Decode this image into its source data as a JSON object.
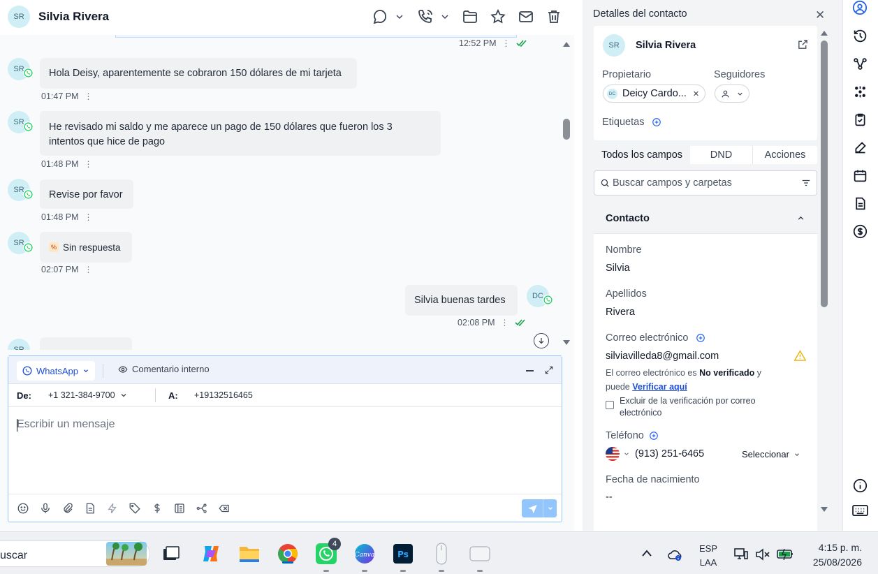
{
  "contact": {
    "initials": "SR",
    "name": "Silvia Rivera"
  },
  "messages": [
    {
      "time": "12:52 PM"
    },
    {
      "initials": "SR",
      "text": "Hola Deisy, aparentemente se cobraron 150 dólares de mi tarjeta",
      "time": "01:47 PM"
    },
    {
      "initials": "SR",
      "text_line1": "He revisado mi saldo y me aparece un pago de 150 dólares que fueron los 3",
      "text_line2": "intentos que hice de pago",
      "time": "01:48 PM"
    },
    {
      "initials": "SR",
      "text": "Revise por favor",
      "time": "01:48 PM"
    },
    {
      "initials": "SR",
      "text": "Sin respuesta",
      "time": "02:07 PM"
    },
    {
      "initials": "DC",
      "text": "Silvia buenas tardes",
      "time": "02:08 PM"
    },
    {
      "initials": "SR"
    }
  ],
  "composer": {
    "channel": "WhatsApp",
    "internal_comment": "Comentario interno",
    "from_label": "De:",
    "from_number": "+1 321-384-9700",
    "to_label": "A:",
    "to_number": "+19132516465",
    "placeholder": "Escribir un mensaje"
  },
  "panel": {
    "title": "Detalles del contacto",
    "contact_initials": "SR",
    "contact_name": "Silvia Rivera",
    "owner_label": "Propietario",
    "owner_initials": "DC",
    "owner_name": "Deicy Cardo...",
    "followers_label": "Seguidores",
    "tags_label": "Etiquetas",
    "tabs": [
      "Todos los campos",
      "DND",
      "Acciones"
    ],
    "search_placeholder": "Buscar campos y carpetas",
    "section_title": "Contacto",
    "first_name_label": "Nombre",
    "first_name": "Silvia",
    "last_name_label": "Apellidos",
    "last_name": "Rivera",
    "email_label": "Correo electrónico",
    "email": "silviavilleda8@gmail.com",
    "email_note_1": "El correo electrónico es",
    "email_note_bold": "No verificado",
    "email_note_2": "y",
    "email_note_3": "puede",
    "verify_link": "Verificar aquí",
    "exclude_label_1": "Excluir de la verificación por correo",
    "exclude_label_2": "electrónico",
    "phone_label": "Teléfono",
    "phone": "(913) 251-6465",
    "phone_type": "Seleccionar",
    "birthday_label": "Fecha de nacimiento",
    "birthday": "--"
  },
  "taskbar": {
    "search": "uscar",
    "whatsapp_badge": "4",
    "lang_1": "ESP",
    "lang_2": "LAA",
    "time": "4:15 p. m.",
    "date": "25/08/2026"
  },
  "colors": {
    "accent": "#2563eb",
    "whatsapp": "#25d366",
    "check": "#16a34a",
    "avatar_bg": "#cfeef6"
  }
}
